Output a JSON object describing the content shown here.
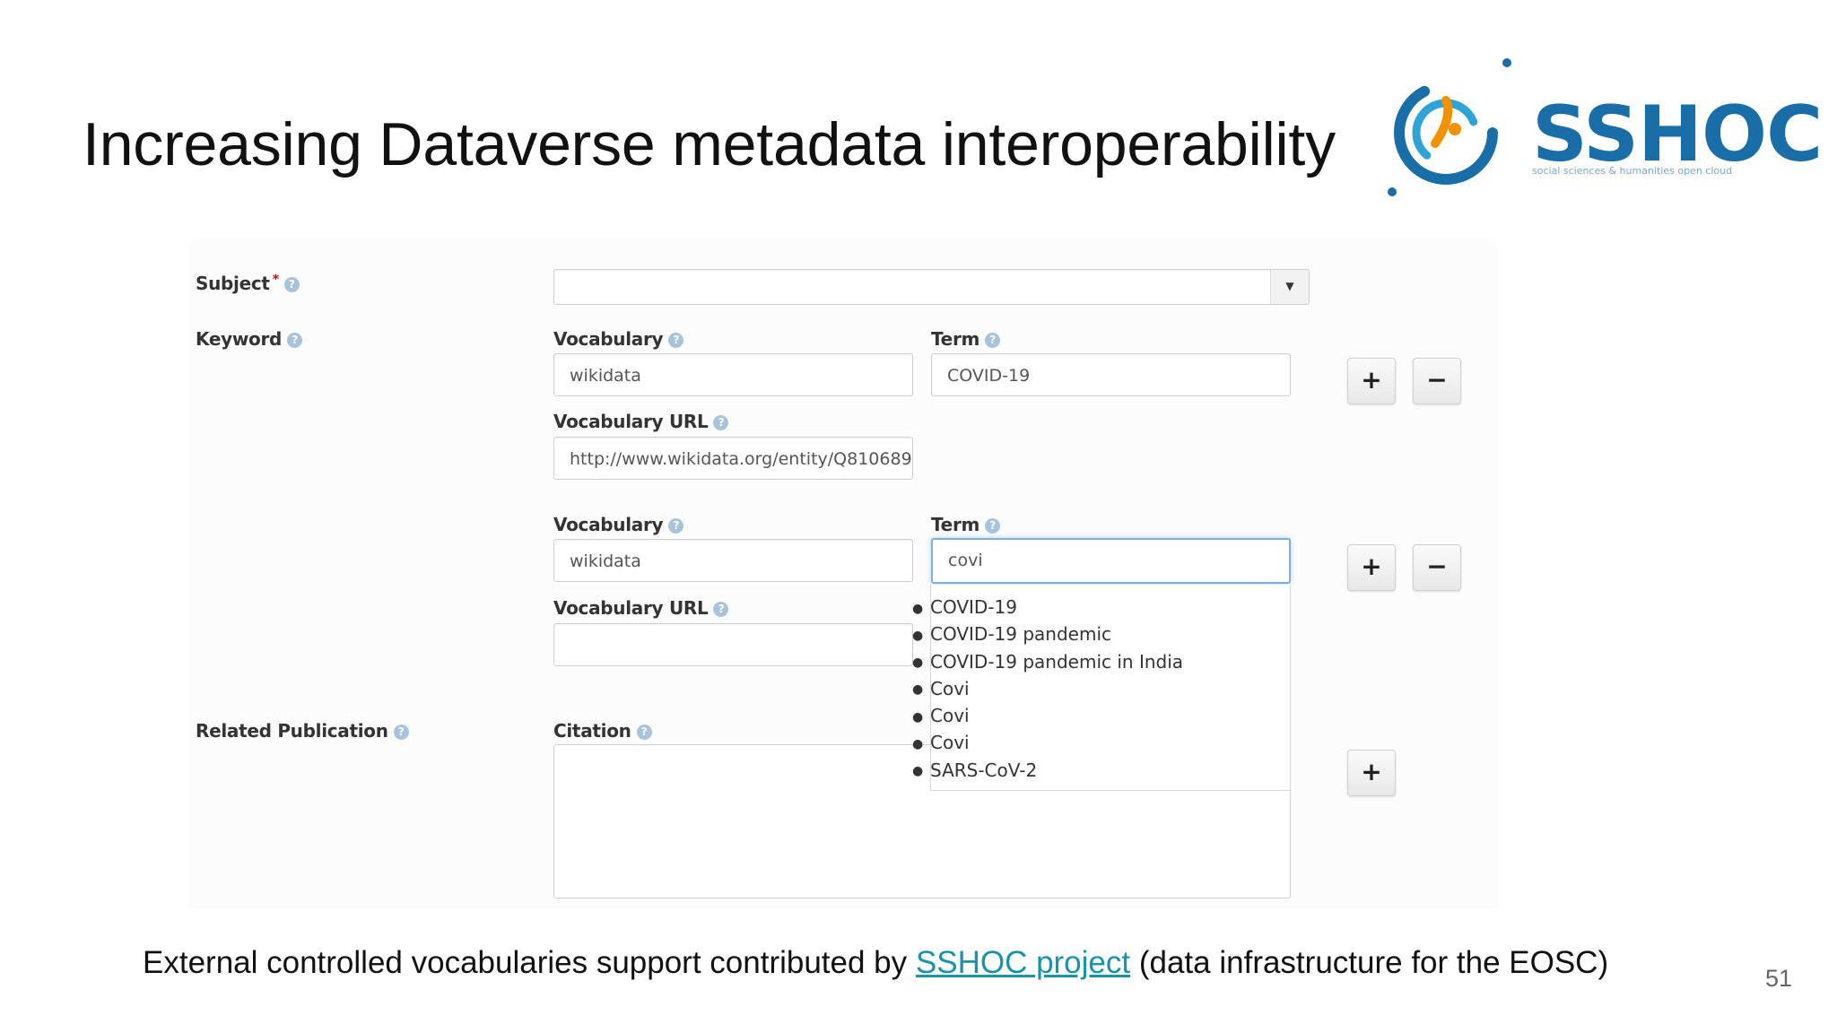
{
  "slide": {
    "title": "Increasing Dataverse metadata interoperability",
    "page_number": "51"
  },
  "logo": {
    "name": "SSHOC",
    "tagline": "social sciences & humanities open cloud"
  },
  "form": {
    "subject": {
      "label": "Subject",
      "required_mark": "*",
      "value": ""
    },
    "keyword": {
      "label": "Keyword",
      "entries": [
        {
          "vocabulary_label": "Vocabulary",
          "vocabulary": "wikidata",
          "term_label": "Term",
          "term": "COVID-19",
          "url_label": "Vocabulary URL",
          "url": "http://www.wikidata.org/entity/Q810689"
        },
        {
          "vocabulary_label": "Vocabulary",
          "vocabulary": "wikidata",
          "term_label": "Term",
          "term": "covi",
          "url_label": "Vocabulary URL",
          "url": ""
        }
      ],
      "suggestions": [
        "COVID-19",
        "COVID-19 pandemic",
        "COVID-19 pandemic in India",
        "Covi",
        "Covi",
        "Covi",
        "SARS-CoV-2"
      ]
    },
    "related_publication": {
      "label": "Related Publication",
      "citation_label": "Citation",
      "citation": ""
    },
    "buttons": {
      "add": "+",
      "remove": "−"
    }
  },
  "footer": {
    "prefix": "External controlled vocabularies support contributed by ",
    "link_text": "SSHOC project",
    "suffix": " (data infrastructure for the EOSC)"
  },
  "colors": {
    "link": "#1a93a8",
    "logo_blue": "#1a6ea8",
    "logo_orange": "#f39200",
    "focus_border": "#7fb0dc"
  },
  "icons": {
    "help": "question-circle-icon",
    "caret": "caret-down-icon"
  }
}
